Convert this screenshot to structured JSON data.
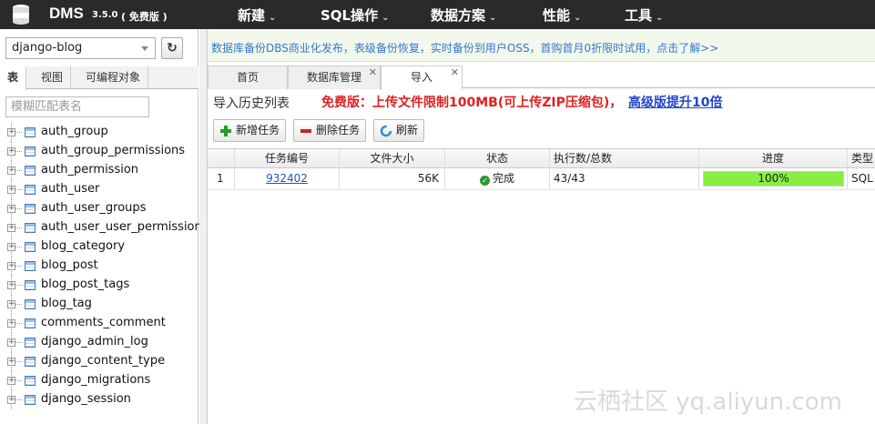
{
  "app": {
    "brand": "DMS",
    "version": "3.5.0",
    "edition": "( 免费版 )"
  },
  "menu": [
    {
      "label": "新建"
    },
    {
      "label": "SQL操作"
    },
    {
      "label": "数据方案"
    },
    {
      "label": "性能"
    },
    {
      "label": "工具"
    }
  ],
  "sidebar": {
    "database": "django-blog",
    "tabs": [
      "表",
      "视图",
      "可编程对象"
    ],
    "filter_placeholder": "模糊匹配表名",
    "tables": [
      "auth_group",
      "auth_group_permissions",
      "auth_permission",
      "auth_user",
      "auth_user_groups",
      "auth_user_user_permissions",
      "blog_category",
      "blog_post",
      "blog_post_tags",
      "blog_tag",
      "comments_comment",
      "django_admin_log",
      "django_content_type",
      "django_migrations",
      "django_session"
    ]
  },
  "banner": {
    "text": "数据库备份DBS商业化发布，表级备份恢复，实时备份到用户OSS，首购首月0折限时试用，点击了解>>"
  },
  "tabs": [
    "首页",
    "数据库管理",
    "导入"
  ],
  "main": {
    "title": "导入历史列表",
    "notice": "免费版：上传文件限制100MB(可上传ZIP压缩包)，",
    "upgrade_link": "高级版提升10倍",
    "buttons": {
      "add": "新增任务",
      "delete": "删除任务",
      "refresh": "刷新"
    }
  },
  "grid": {
    "columns": [
      "任务编号",
      "文件大小",
      "状态",
      "执行数/总数",
      "进度",
      "类型"
    ],
    "rows": [
      {
        "index": "1",
        "task_id": "932402",
        "size": "56K",
        "status": "完成",
        "exec": "43/43",
        "progress_label": "100%",
        "progress": 1.0,
        "type": "SQL"
      }
    ]
  },
  "watermark": "云栖社区 yq.aliyun.com",
  "colors": {
    "topbar": "#2a2a2a",
    "progress": "#88ee44",
    "notice": "#e02020",
    "link": "#2255bb"
  }
}
